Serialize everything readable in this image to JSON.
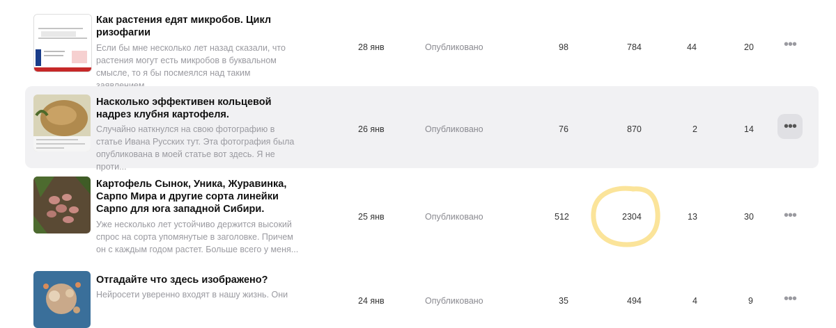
{
  "articles": [
    {
      "title": "Как растения едят микробов. Цикл ризофагии",
      "snippet": "Если бы мне несколько лет назад сказали, что растения могут есть микробов в буквальном смысле, то я бы посмеялся над таким заявлением....",
      "date": "28 янв",
      "status": "Опубликовано",
      "views": "98",
      "impressions": "784",
      "likes": "44",
      "comments": "20",
      "menu": "•••"
    },
    {
      "title": "Насколько эффективен кольцевой надрез клубня картофеля.",
      "snippet": "Случайно наткнулся на свою фотографию в статье Ивана Русских тут. Эта фотография была опубликована в моей статье вот здесь. Я не проти...",
      "date": "26 янв",
      "status": "Опубликовано",
      "views": "76",
      "impressions": "870",
      "likes": "2",
      "comments": "14",
      "menu": "•••"
    },
    {
      "title": "Картофель Сынок, Уника, Журавинка, Сарпо Мира и другие сорта линейки Сарпо для юга западной Сибири.",
      "snippet": "Уже несколько лет устойчиво держится высокий спрос на сорта упомянутые в заголовке. Причем он с каждым годом растет. Больше всего у меня...",
      "date": "25 янв",
      "status": "Опубликовано",
      "views": "512",
      "impressions": "2304",
      "likes": "13",
      "comments": "30",
      "menu": "•••"
    },
    {
      "title": "Отгадайте что здесь изображено?",
      "snippet": "Нейросети уверенно входят в нашу жизнь. Они",
      "date": "24 янв",
      "status": "Опубликовано",
      "views": "35",
      "impressions": "494",
      "likes": "4",
      "comments": "9",
      "menu": "•••"
    }
  ],
  "colors": {
    "hover_row": "#f1f1f3",
    "highlight_marker": "#fbe49a"
  }
}
